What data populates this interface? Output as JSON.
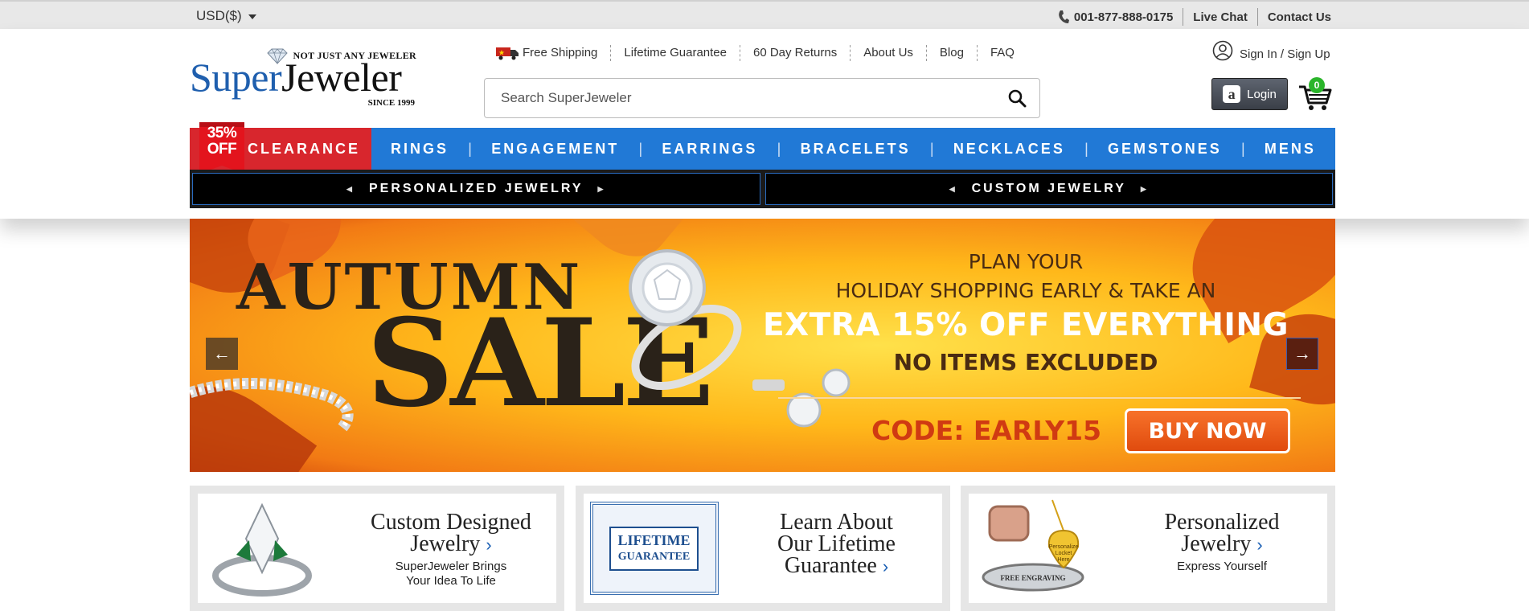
{
  "topbar": {
    "currency": "USD($)",
    "phone": "001-877-888-0175",
    "live_chat": "Live Chat",
    "contact": "Contact Us"
  },
  "logo": {
    "tagline": "NOT JUST ANY JEWELER",
    "brand_first": "Super",
    "brand_second": "Jeweler",
    "since": "SINCE 1999"
  },
  "header_links": [
    "Free Shipping",
    "Lifetime Guarantee",
    "60 Day Returns",
    "About Us",
    "Blog",
    "FAQ"
  ],
  "search": {
    "placeholder": "Search SuperJeweler"
  },
  "account": {
    "signin": "Sign In / Sign Up",
    "login": "Login",
    "cart_count": "0"
  },
  "nav": {
    "ribbon_pct": "35%",
    "ribbon_off": "OFF",
    "clearance": "CLEARANCE",
    "items": [
      "RINGS",
      "ENGAGEMENT",
      "EARRINGS",
      "BRACELETS",
      "NECKLACES",
      "GEMSTONES",
      "MENS"
    ]
  },
  "subnav": {
    "left": "PERSONALIZED JEWELRY",
    "right": "CUSTOM JEWELRY"
  },
  "banner": {
    "autumn": "AUTUMN",
    "sale": "SALE",
    "plan_line1": "PLAN YOUR",
    "plan_line2": "HOLIDAY SHOPPING EARLY & TAKE AN",
    "extra": "EXTRA 15% OFF EVERYTHING",
    "no_items": "NO ITEMS EXCLUDED",
    "code": "CODE: EARLY15",
    "buy": "BUY NOW"
  },
  "promos": [
    {
      "title_line1": "Custom Designed",
      "title_line2": "Jewelry",
      "sub_line1": "SuperJeweler Brings",
      "sub_line2": "Your Idea To Life"
    },
    {
      "title_line1": "Learn About",
      "title_line2": "Our Lifetime",
      "title_line3": "Guarantee",
      "badge_line1": "LIFETIME",
      "badge_line2": "GUARANTEE"
    },
    {
      "title_line1": "Personalized",
      "title_line2": "Jewelry",
      "sub_line1": "Express Yourself",
      "locket_line1": "Personalize",
      "locket_line2": "Locket",
      "locket_line3": "Here",
      "engraving": "FREE ENGRAVING"
    }
  ],
  "colors": {
    "nav_blue": "#2179d6",
    "clearance_red": "#d8262d",
    "brand_blue": "#1f5fae",
    "cart_badge": "#2bb52b",
    "buy_orange": "#e04b0e"
  }
}
